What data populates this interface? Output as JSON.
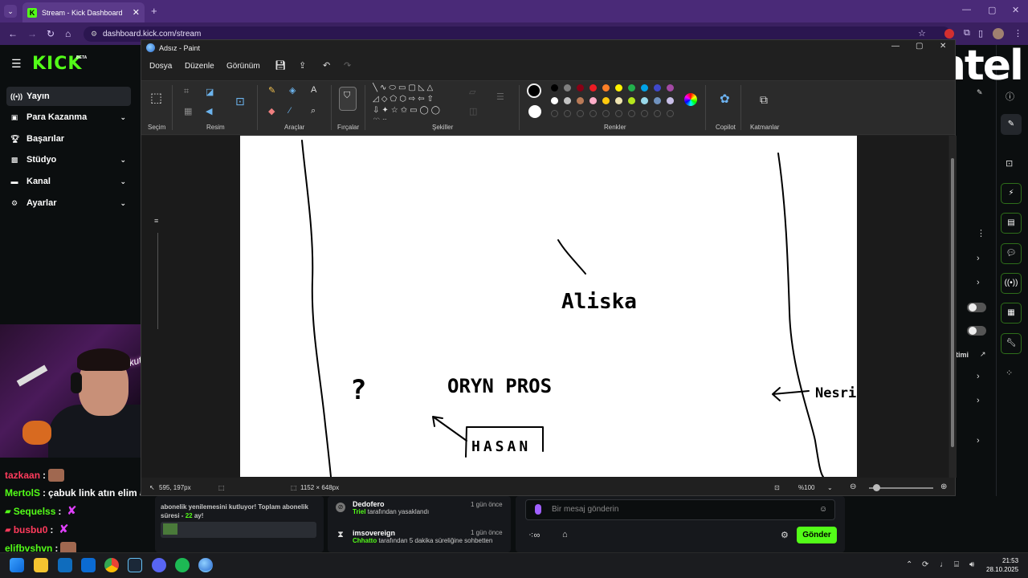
{
  "browser": {
    "tab_title": "Stream - Kick Dashboard",
    "url": "dashboard.kick.com/stream"
  },
  "kick": {
    "logo": "KICK",
    "beta": "BETA",
    "nav": [
      {
        "label": "Yayın",
        "icon": "broadcast-icon",
        "active": true
      },
      {
        "label": "Para Kazanma",
        "icon": "money-icon",
        "chevron": true
      },
      {
        "label": "Başarılar",
        "icon": "trophy-icon"
      },
      {
        "label": "Stüdyo",
        "icon": "studio-icon",
        "chevron": true
      },
      {
        "label": "Kanal",
        "icon": "channel-icon",
        "chevron": true
      },
      {
        "label": "Ayarlar",
        "icon": "settings-icon",
        "chevron": true
      }
    ],
    "webcam_neon": "kutman"
  },
  "chat_overlay": [
    {
      "user": "tazkaan",
      "color": "#ff3b5c",
      "message": "",
      "emote": "face"
    },
    {
      "user": "MertolS",
      "color": "#53fc18",
      "message": "çabuk link atın elim ayagım titriyo",
      "emote": ""
    },
    {
      "user": "Sequelss",
      "color": "#53fc18",
      "message": "",
      "emote": "x"
    },
    {
      "user": "busbu0",
      "color": "#ff3b5c",
      "message": "",
      "emote": "x"
    },
    {
      "user": "elifbvshvn",
      "color": "#53fc18",
      "message": "",
      "emote": "face"
    }
  ],
  "dashboard": {
    "sub_text_pre": "abonelik yenilemesini kutluyor! Toplam abonelik süresi - ",
    "sub_months": "22",
    "sub_text_post": " ay!",
    "activity": [
      {
        "user": "Dedofero",
        "time": "1 gün önce",
        "actor": "Triel",
        "text": " tarafından yasaklandı"
      },
      {
        "user": "imsovereign",
        "time": "1 gün önce",
        "actor": "Chhatto",
        "text": " tarafından 5 dakika süreliğine sohbetten"
      }
    ],
    "message_placeholder": "Bir mesaj gönderin",
    "send_label": "Gönder",
    "right_col_text": "timi"
  },
  "paint": {
    "title": "Adsız - Paint",
    "menus": [
      "Dosya",
      "Düzenle",
      "Görünüm"
    ],
    "groups": [
      "Seçim",
      "Resim",
      "Araçlar",
      "Fırçalar",
      "Şekiller",
      "Renkler",
      "Copilot",
      "Katmanlar"
    ],
    "colors_row1": [
      "#000000",
      "#7f7f7f",
      "#880015",
      "#ed1c24",
      "#ff7f27",
      "#fff200",
      "#22b14c",
      "#00a2e8",
      "#3f48cc",
      "#a349a4"
    ],
    "colors_row2": [
      "#ffffff",
      "#c3c3c3",
      "#b97a57",
      "#ffaec9",
      "#ffc90e",
      "#efe4b0",
      "#b5e61d",
      "#99d9ea",
      "#7092be",
      "#c8bfe7"
    ],
    "primary_color": "#000000",
    "secondary_color": "#ffffff",
    "canvas_size": "1152 × 648px",
    "cursor_pos": "595, 197px",
    "zoom": "%100",
    "drawing_texts": {
      "aliska": "Aliska",
      "question": "?",
      "oryn_pros": "ORYN PROS",
      "hasan": "HASAN",
      "nesrin": "Nesrin"
    }
  },
  "watermark": "intel",
  "taskbar": {
    "time": "21:53",
    "date": "28.10.2025"
  }
}
